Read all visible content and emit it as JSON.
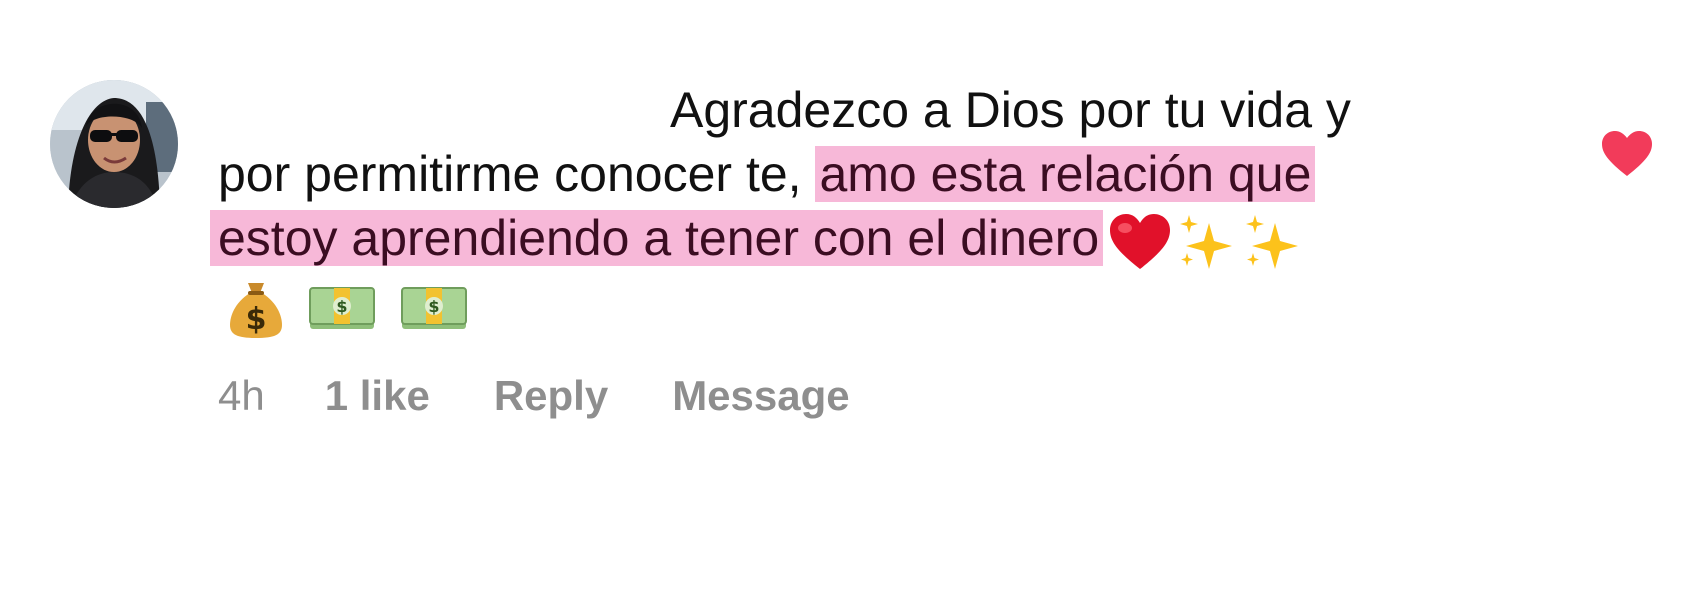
{
  "comment": {
    "text_line1": "Agradezco a Dios por tu vida y",
    "text_line2_plain": "por permitirme conocer te, ",
    "text_line2_highlight": "amo esta relación que",
    "text_line3_highlight": "estoy aprendiendo a tener con el dinero",
    "emojis_line3": [
      "red-heart-icon",
      "sparkles-icon",
      "sparkles-icon"
    ],
    "emojis_line4": [
      "money-bag-icon",
      "dollar-banknote-icon",
      "dollar-banknote-icon"
    ],
    "highlight_color": "#f7b8d8"
  },
  "actions": {
    "time": "4h",
    "likes": "1 like",
    "reply": "Reply",
    "message": "Message"
  },
  "like_icon": {
    "name": "heart-icon",
    "color": "#f23b5a",
    "liked": true
  }
}
